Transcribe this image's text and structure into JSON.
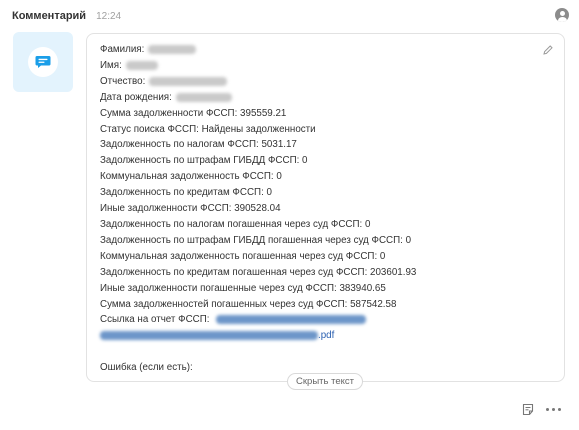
{
  "header": {
    "author": "Комментарий",
    "time": "12:24"
  },
  "icons": {
    "avatar": "chat-bubble-icon",
    "user": "user-icon",
    "edit": "pencil-icon",
    "note": "note-icon",
    "more": "more-dots-icon"
  },
  "colors": {
    "avatar_bg": "#e3f3fd",
    "accent": "#1a9ee8",
    "link": "#2a5fb0"
  },
  "fields": {
    "lastname_label": "Фамилия:",
    "firstname_label": "Имя:",
    "patronymic_label": "Отчество:",
    "birthdate_label": "Дата рождения:"
  },
  "lines": [
    "Сумма задолженности ФССП: 395559.21",
    "Статус поиска ФССП: Найдены задолженности",
    "Задолженность по налогам ФССП: 5031.17",
    "Задолженность по штрафам ГИБДД ФССП: 0",
    "Коммунальная задолженность ФССП: 0",
    "Задолженность по кредитам ФССП: 0",
    "Иные задолженности ФССП: 390528.04",
    "Задолженность по налогам погашенная через суд ФССП: 0",
    "Задолженность по штрафам ГИБДД погашенная через суд ФССП: 0",
    "Коммунальная задолженность погашенная через суд ФССП: 0",
    "Задолженность по кредитам погашенная через суд ФССП: 203601.93",
    "Иные задолженности погашенные через суд ФССП: 383940.65",
    "Сумма задолженностей погашенных через суд ФССП: 587542.58"
  ],
  "report": {
    "label": "Ссылка на отчет ФССП:",
    "file_ext": ".pdf"
  },
  "error_label": "Ошибка (если есть):",
  "hide_text_button": "Скрыть текст"
}
